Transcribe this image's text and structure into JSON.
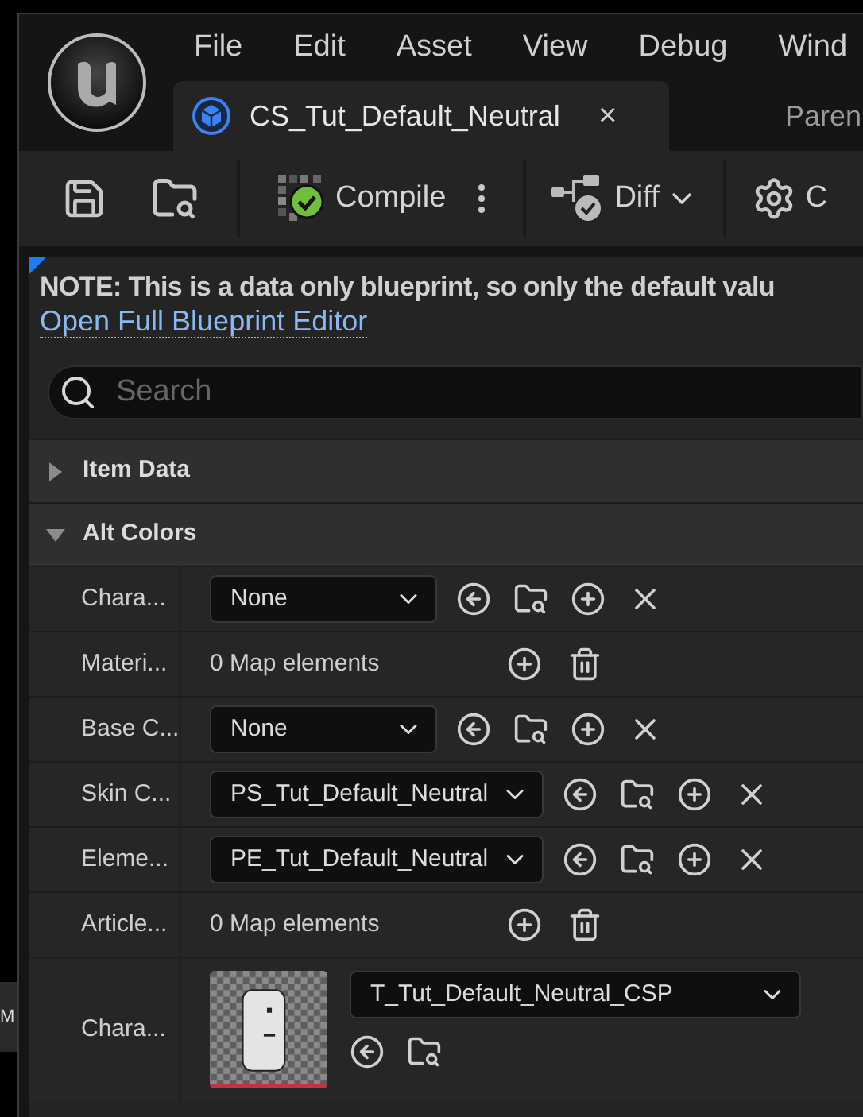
{
  "window": {
    "menu": [
      "File",
      "Edit",
      "Asset",
      "View",
      "Debug",
      "Wind"
    ],
    "tab": {
      "title": "CS_Tut_Default_Neutral",
      "close": "×"
    },
    "parent_label": "Paren"
  },
  "toolbar": {
    "compile": "Compile",
    "diff": "Diff",
    "settings_label": "C"
  },
  "note": {
    "text": "NOTE: This is a data only blueprint, so only the default valu",
    "link": "Open Full Blueprint Editor"
  },
  "search": {
    "placeholder": "Search"
  },
  "sections": [
    {
      "title": "Item Data",
      "expanded": false
    },
    {
      "title": "Alt Colors",
      "expanded": true,
      "rows": [
        {
          "kind": "asset",
          "label": "Chara...",
          "value": "None"
        },
        {
          "kind": "map",
          "label": "Materi...",
          "value": "0 Map elements"
        },
        {
          "kind": "asset",
          "label": "Base C...",
          "value": "None"
        },
        {
          "kind": "asset",
          "label": "Skin C...",
          "value": "PS_Tut_Default_Neutral"
        },
        {
          "kind": "asset",
          "label": "Eleme...",
          "value": "PE_Tut_Default_Neutral"
        },
        {
          "kind": "map",
          "label": "Article...",
          "value": "0 Map elements"
        },
        {
          "kind": "texture",
          "label": "Chara...",
          "value": "T_Tut_Default_Neutral_CSP"
        }
      ]
    }
  ],
  "side_window": {
    "label": "M"
  }
}
